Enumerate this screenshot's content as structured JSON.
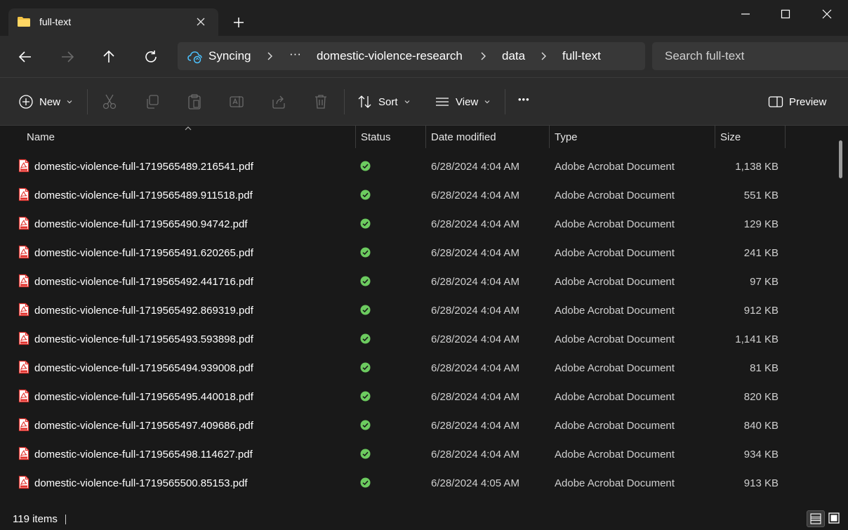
{
  "window": {
    "tab_title": "full-text",
    "icons": {
      "tab": "folder-icon",
      "close": "close-icon",
      "new_tab": "plus-icon",
      "minimize": "minimize-icon",
      "maximize": "maximize-icon",
      "close_window": "close-icon"
    }
  },
  "address": {
    "breadcrumbs": [
      "Syncing",
      "domestic-violence-research",
      "data",
      "full-text"
    ],
    "overflow": "···",
    "search_placeholder": "Search full-text"
  },
  "toolbar": {
    "new_label": "New",
    "sort_label": "Sort",
    "view_label": "View",
    "more_label": "•••",
    "preview_label": "Preview"
  },
  "columns": [
    "Name",
    "Status",
    "Date modified",
    "Type",
    "Size"
  ],
  "files": [
    {
      "name": "domestic-violence-full-1719565489.216541.pdf",
      "date": "6/28/2024 4:04 AM",
      "type": "Adobe Acrobat Document",
      "size": "1,138 KB"
    },
    {
      "name": "domestic-violence-full-1719565489.911518.pdf",
      "date": "6/28/2024 4:04 AM",
      "type": "Adobe Acrobat Document",
      "size": "551 KB"
    },
    {
      "name": "domestic-violence-full-1719565490.94742.pdf",
      "date": "6/28/2024 4:04 AM",
      "type": "Adobe Acrobat Document",
      "size": "129 KB"
    },
    {
      "name": "domestic-violence-full-1719565491.620265.pdf",
      "date": "6/28/2024 4:04 AM",
      "type": "Adobe Acrobat Document",
      "size": "241 KB"
    },
    {
      "name": "domestic-violence-full-1719565492.441716.pdf",
      "date": "6/28/2024 4:04 AM",
      "type": "Adobe Acrobat Document",
      "size": "97 KB"
    },
    {
      "name": "domestic-violence-full-1719565492.869319.pdf",
      "date": "6/28/2024 4:04 AM",
      "type": "Adobe Acrobat Document",
      "size": "912 KB"
    },
    {
      "name": "domestic-violence-full-1719565493.593898.pdf",
      "date": "6/28/2024 4:04 AM",
      "type": "Adobe Acrobat Document",
      "size": "1,141 KB"
    },
    {
      "name": "domestic-violence-full-1719565494.939008.pdf",
      "date": "6/28/2024 4:04 AM",
      "type": "Adobe Acrobat Document",
      "size": "81 KB"
    },
    {
      "name": "domestic-violence-full-1719565495.440018.pdf",
      "date": "6/28/2024 4:04 AM",
      "type": "Adobe Acrobat Document",
      "size": "820 KB"
    },
    {
      "name": "domestic-violence-full-1719565497.409686.pdf",
      "date": "6/28/2024 4:04 AM",
      "type": "Adobe Acrobat Document",
      "size": "840 KB"
    },
    {
      "name": "domestic-violence-full-1719565498.114627.pdf",
      "date": "6/28/2024 4:04 AM",
      "type": "Adobe Acrobat Document",
      "size": "934 KB"
    },
    {
      "name": "domestic-violence-full-1719565500.85153.pdf",
      "date": "6/28/2024 4:05 AM",
      "type": "Adobe Acrobat Document",
      "size": "913 KB"
    }
  ],
  "status_bar": {
    "item_count": "119 items"
  },
  "colors": {
    "accent_green": "#6ccb5f",
    "pdf_red": "#e2322d",
    "sync_blue": "#4cc2ff"
  }
}
